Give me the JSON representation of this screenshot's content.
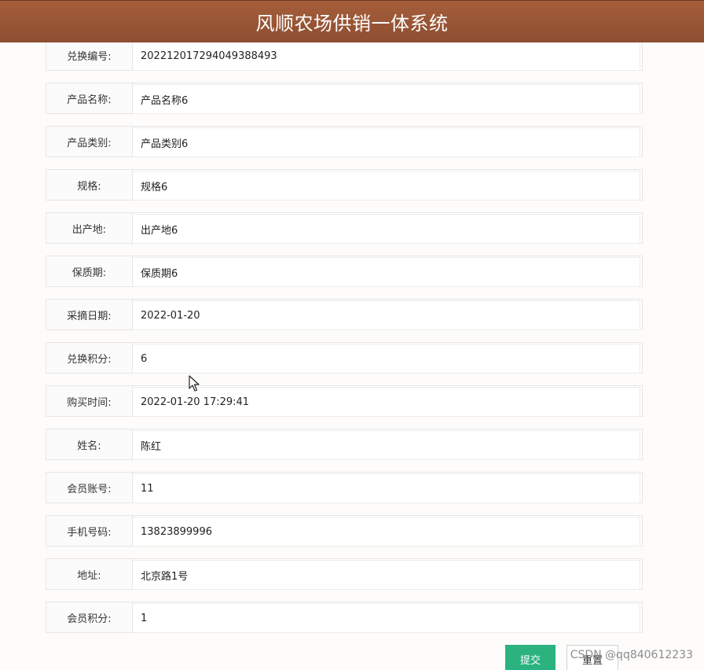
{
  "header": {
    "title": "风顺农场供销一体系统"
  },
  "form": {
    "rows": [
      {
        "label": "兑换编号:",
        "value": "202212017294049388493"
      },
      {
        "label": "产品名称:",
        "value": "产品名称6"
      },
      {
        "label": "产品类别:",
        "value": "产品类别6"
      },
      {
        "label": "规格:",
        "value": "规格6"
      },
      {
        "label": "出产地:",
        "value": "出产地6"
      },
      {
        "label": "保质期:",
        "value": "保质期6"
      },
      {
        "label": "采摘日期:",
        "value": "2022-01-20"
      },
      {
        "label": "兑换积分:",
        "value": "6"
      },
      {
        "label": "购买时间:",
        "value": "2022-01-20 17:29:41"
      },
      {
        "label": "姓名:",
        "value": "陈红"
      },
      {
        "label": "会员账号:",
        "value": "11"
      },
      {
        "label": "手机号码:",
        "value": "13823899996"
      },
      {
        "label": "地址:",
        "value": "北京路1号"
      },
      {
        "label": "会员积分:",
        "value": "1"
      }
    ]
  },
  "actions": {
    "submit_label": "提交",
    "reset_label": "重置"
  },
  "watermark": "CSDN @qq840612233"
}
